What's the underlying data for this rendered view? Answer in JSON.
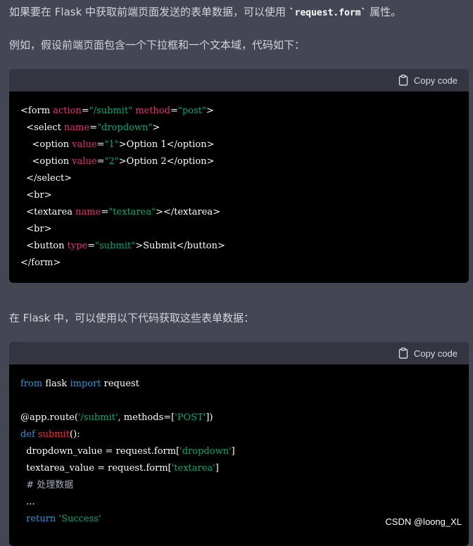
{
  "paragraphs": {
    "p1_before": "如果要在 Flask 中获取前端页面发送的表单数据，可以使用 ",
    "p1_code": "`request.form`",
    "p1_after": " 属性。",
    "p2": "例如，假设前端页面包含一个下拉框和一个文本域，代码如下：",
    "p3": "在 Flask 中，可以使用以下代码获取这些表单数据："
  },
  "code_block_1": {
    "copy_label": "Copy code",
    "lines": [
      [
        [
          "plain",
          "<form "
        ],
        [
          "attr",
          "action"
        ],
        [
          "plain",
          "="
        ],
        [
          "str",
          "\"/submit\""
        ],
        [
          "plain",
          " "
        ],
        [
          "attr",
          "method"
        ],
        [
          "plain",
          "="
        ],
        [
          "str",
          "\"post\""
        ],
        [
          "plain",
          ">"
        ]
      ],
      [
        [
          "plain",
          "  <select "
        ],
        [
          "attr",
          "name"
        ],
        [
          "plain",
          "="
        ],
        [
          "str",
          "\"dropdown\""
        ],
        [
          "plain",
          ">"
        ]
      ],
      [
        [
          "plain",
          "    <option "
        ],
        [
          "attr",
          "value"
        ],
        [
          "plain",
          "="
        ],
        [
          "str",
          "\"1\""
        ],
        [
          "plain",
          ">Option 1</option>"
        ]
      ],
      [
        [
          "plain",
          "    <option "
        ],
        [
          "attr",
          "value"
        ],
        [
          "plain",
          "="
        ],
        [
          "str",
          "\"2\""
        ],
        [
          "plain",
          ">Option 2</option>"
        ]
      ],
      [
        [
          "plain",
          "  </select>"
        ]
      ],
      [
        [
          "plain",
          "  <br>"
        ]
      ],
      [
        [
          "plain",
          "  <textarea "
        ],
        [
          "attr",
          "name"
        ],
        [
          "plain",
          "="
        ],
        [
          "str",
          "\"textarea\""
        ],
        [
          "plain",
          "></textarea>"
        ]
      ],
      [
        [
          "plain",
          "  <br>"
        ]
      ],
      [
        [
          "plain",
          "  <button "
        ],
        [
          "attr",
          "type"
        ],
        [
          "plain",
          "="
        ],
        [
          "str",
          "\"submit\""
        ],
        [
          "plain",
          ">Submit</button>"
        ]
      ],
      [
        [
          "plain",
          "</form>"
        ]
      ]
    ]
  },
  "code_block_2": {
    "copy_label": "Copy code",
    "lines": [
      [
        [
          "kw",
          "from"
        ],
        [
          "plain",
          " flask "
        ],
        [
          "kw",
          "import"
        ],
        [
          "plain",
          " request"
        ]
      ],
      [
        [
          "plain",
          ""
        ]
      ],
      [
        [
          "plain",
          "@app.route("
        ],
        [
          "str",
          "'/submit'"
        ],
        [
          "plain",
          ", methods=["
        ],
        [
          "str",
          "'POST'"
        ],
        [
          "plain",
          "])"
        ]
      ],
      [
        [
          "kw",
          "def"
        ],
        [
          "plain",
          " "
        ],
        [
          "fn",
          "submit"
        ],
        [
          "plain",
          "():"
        ]
      ],
      [
        [
          "plain",
          "  dropdown_value = request.form["
        ],
        [
          "str",
          "'dropdown'"
        ],
        [
          "plain",
          "]"
        ]
      ],
      [
        [
          "plain",
          "  textarea_value = request.form["
        ],
        [
          "str",
          "'textarea'"
        ],
        [
          "plain",
          "]"
        ]
      ],
      [
        [
          "cmt",
          "  # 处理数据"
        ]
      ],
      [
        [
          "plain",
          "  ..."
        ]
      ],
      [
        [
          "plain",
          "  "
        ],
        [
          "kw",
          "return"
        ],
        [
          "plain",
          " "
        ],
        [
          "str",
          "'Success'"
        ]
      ]
    ]
  },
  "watermark": "CSDN @loong_XL",
  "colors": {
    "page_bg": "#444654",
    "code_bg": "#000000",
    "code_header_bg": "#343541",
    "keyword": "#2e95d3",
    "function": "#f22c3d",
    "attribute": "#df3079",
    "string": "#00a67d"
  },
  "icons": {
    "copy": "clipboard-icon"
  }
}
